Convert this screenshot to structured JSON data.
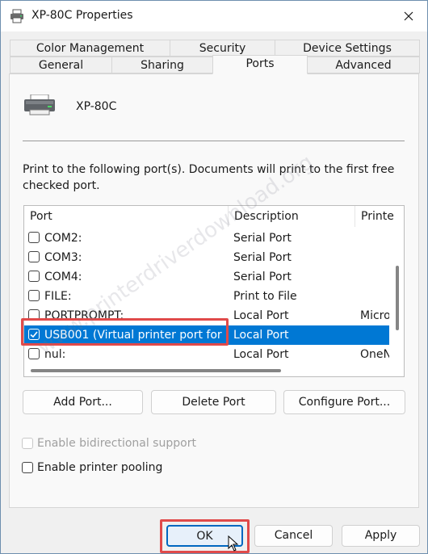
{
  "window": {
    "title": "XP-80C Properties",
    "close_icon": "close-icon"
  },
  "tabs": {
    "row_top": [
      {
        "label": "Color Management"
      },
      {
        "label": "Security"
      },
      {
        "label": "Device Settings"
      }
    ],
    "row_bottom": [
      {
        "label": "General"
      },
      {
        "label": "Sharing"
      },
      {
        "label": "Ports",
        "active": true
      },
      {
        "label": "Advanced"
      }
    ]
  },
  "printer": {
    "icon": "printer-icon",
    "name": "XP-80C"
  },
  "instruction": "Print to the following port(s). Documents will print to the first free checked port.",
  "ports_table": {
    "columns": [
      "Port",
      "Description",
      "Printe"
    ],
    "rows": [
      {
        "checked": false,
        "port": "COM2:",
        "description": "Serial Port",
        "printer": ""
      },
      {
        "checked": false,
        "port": "COM3:",
        "description": "Serial Port",
        "printer": ""
      },
      {
        "checked": false,
        "port": "COM4:",
        "description": "Serial Port",
        "printer": ""
      },
      {
        "checked": false,
        "port": "FILE:",
        "description": "Print to File",
        "printer": ""
      },
      {
        "checked": false,
        "port": "PORTPROMPT:",
        "description": "Local Port",
        "printer": "Micro"
      },
      {
        "checked": true,
        "selected": true,
        "port": "USB001 (Virtual printer port for ...",
        "description": "Local Port",
        "printer": ""
      },
      {
        "checked": false,
        "port": "nul:",
        "description": "Local Port",
        "printer": "OneN"
      }
    ]
  },
  "buttons": {
    "add_port": "Add Port...",
    "delete_port": "Delete Port",
    "configure_port": "Configure Port..."
  },
  "options": {
    "bidirectional": {
      "label": "Enable bidirectional support",
      "checked": false,
      "enabled": false
    },
    "pooling": {
      "label": "Enable printer pooling",
      "checked": false,
      "enabled": true
    }
  },
  "footer": {
    "ok": "OK",
    "cancel": "Cancel",
    "apply": "Apply"
  },
  "watermark": "www.printerdriverdownload.org",
  "colors": {
    "selection": "#0078d4",
    "highlight_box": "#e04a4a",
    "default_button_border": "#0067c0"
  }
}
